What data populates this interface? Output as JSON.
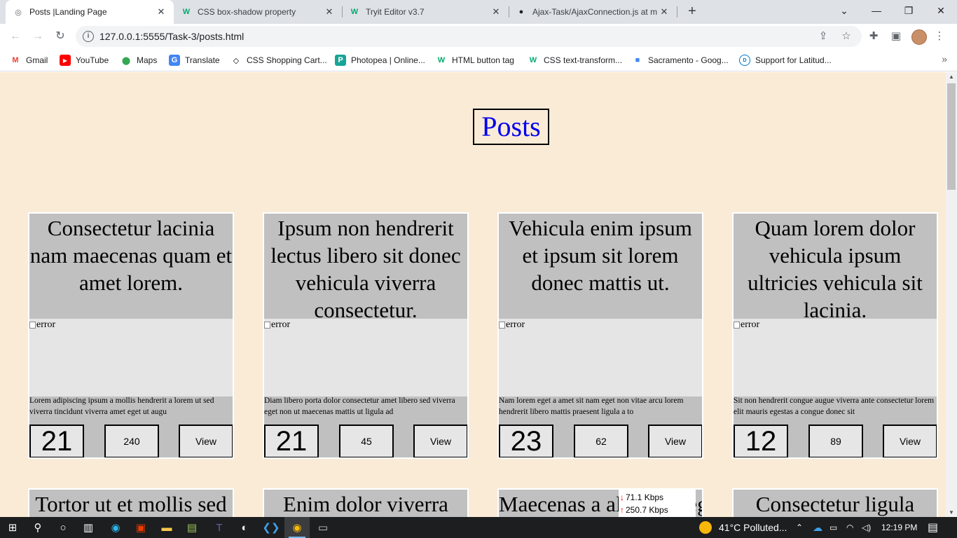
{
  "browser": {
    "tabs": [
      {
        "title": "Posts |Landing Page",
        "active": true
      },
      {
        "title": "CSS box-shadow property",
        "active": false
      },
      {
        "title": "Tryit Editor v3.7",
        "active": false
      },
      {
        "title": "Ajax-Task/AjaxConnection.js at m",
        "active": false
      }
    ],
    "new_tab_symbol": "+",
    "window_controls": {
      "tab_search": "⌄",
      "minimize": "—",
      "restore": "❐",
      "close": "✕"
    },
    "url": "127.0.0.1:5555/Task-3/posts.html",
    "info_symbol": "i",
    "bookmarks": [
      {
        "label": "Gmail",
        "icon": "gmail-icon",
        "glyph": "M",
        "color": "#ea4335"
      },
      {
        "label": "YouTube",
        "icon": "youtube-icon",
        "glyph": "▶",
        "color": "#ff0000"
      },
      {
        "label": "Maps",
        "icon": "maps-icon",
        "glyph": "●",
        "color": "#34a853"
      },
      {
        "label": "Translate",
        "icon": "translate-icon",
        "glyph": "G",
        "color": "#4285f4"
      },
      {
        "label": "CSS Shopping Cart...",
        "icon": "codepen-icon",
        "glyph": "◇",
        "color": "#000000"
      },
      {
        "label": "Photopea | Online...",
        "icon": "photopea-icon",
        "glyph": "P",
        "color": "#18a497"
      },
      {
        "label": "HTML button tag",
        "icon": "w3schools-icon",
        "glyph": "W",
        "color": "#04aa6d"
      },
      {
        "label": "CSS text-transform...",
        "icon": "w3schools-icon",
        "glyph": "W",
        "color": "#04aa6d"
      },
      {
        "label": "Sacramento - Goog...",
        "icon": "google-fonts-icon",
        "glyph": "■",
        "color": "#4285f4"
      },
      {
        "label": "Support for Latitud...",
        "icon": "dell-icon",
        "glyph": "D",
        "color": "#0076ce"
      }
    ],
    "bookmarks_more": "»"
  },
  "page": {
    "title": "Posts",
    "image_alt": "error",
    "view_label": "View",
    "posts": [
      {
        "title": "Consectetur lacinia nam maecenas quam et amet lorem.",
        "body": "Lorem adipiscing ipsum a mollis hendrerit a lorem ut sed viverra tincidunt viverra amet eget ut augu",
        "user_id": "21",
        "count": "240"
      },
      {
        "title": "Ipsum non hendrerit lectus libero sit donec vehicula viverra consectetur.",
        "body": "Diam libero porta dolor consectetur amet libero sed viverra eget non ut maecenas mattis ut ligula ad",
        "user_id": "21",
        "count": "45"
      },
      {
        "title": "Vehicula enim ipsum et ipsum sit lorem donec mattis ut.",
        "body": "Nam lorem eget a amet sit nam eget non vitae arcu lorem hendrerit libero mattis praesent ligula a to",
        "user_id": "23",
        "count": "62"
      },
      {
        "title": "Quam lorem dolor vehicula ipsum ultricies vehicula sit lacinia.",
        "body": "Sit non hendrerit congue augue viverra ante consectetur lorem elit mauris egestas a congue donec sit",
        "user_id": "12",
        "count": "89"
      }
    ],
    "posts_row2": [
      {
        "title": "Tortor ut et mollis sed"
      },
      {
        "title": "Enim dolor viverra"
      },
      {
        "title": "Maecenas a aliquam leg"
      },
      {
        "title": "Consectetur ligula"
      }
    ]
  },
  "net_monitor": {
    "down": "71.1 Kbps",
    "up": "250.7 Kbps"
  },
  "taskbar": {
    "weather": "41°C  Polluted...",
    "time": "12:19 PM"
  }
}
